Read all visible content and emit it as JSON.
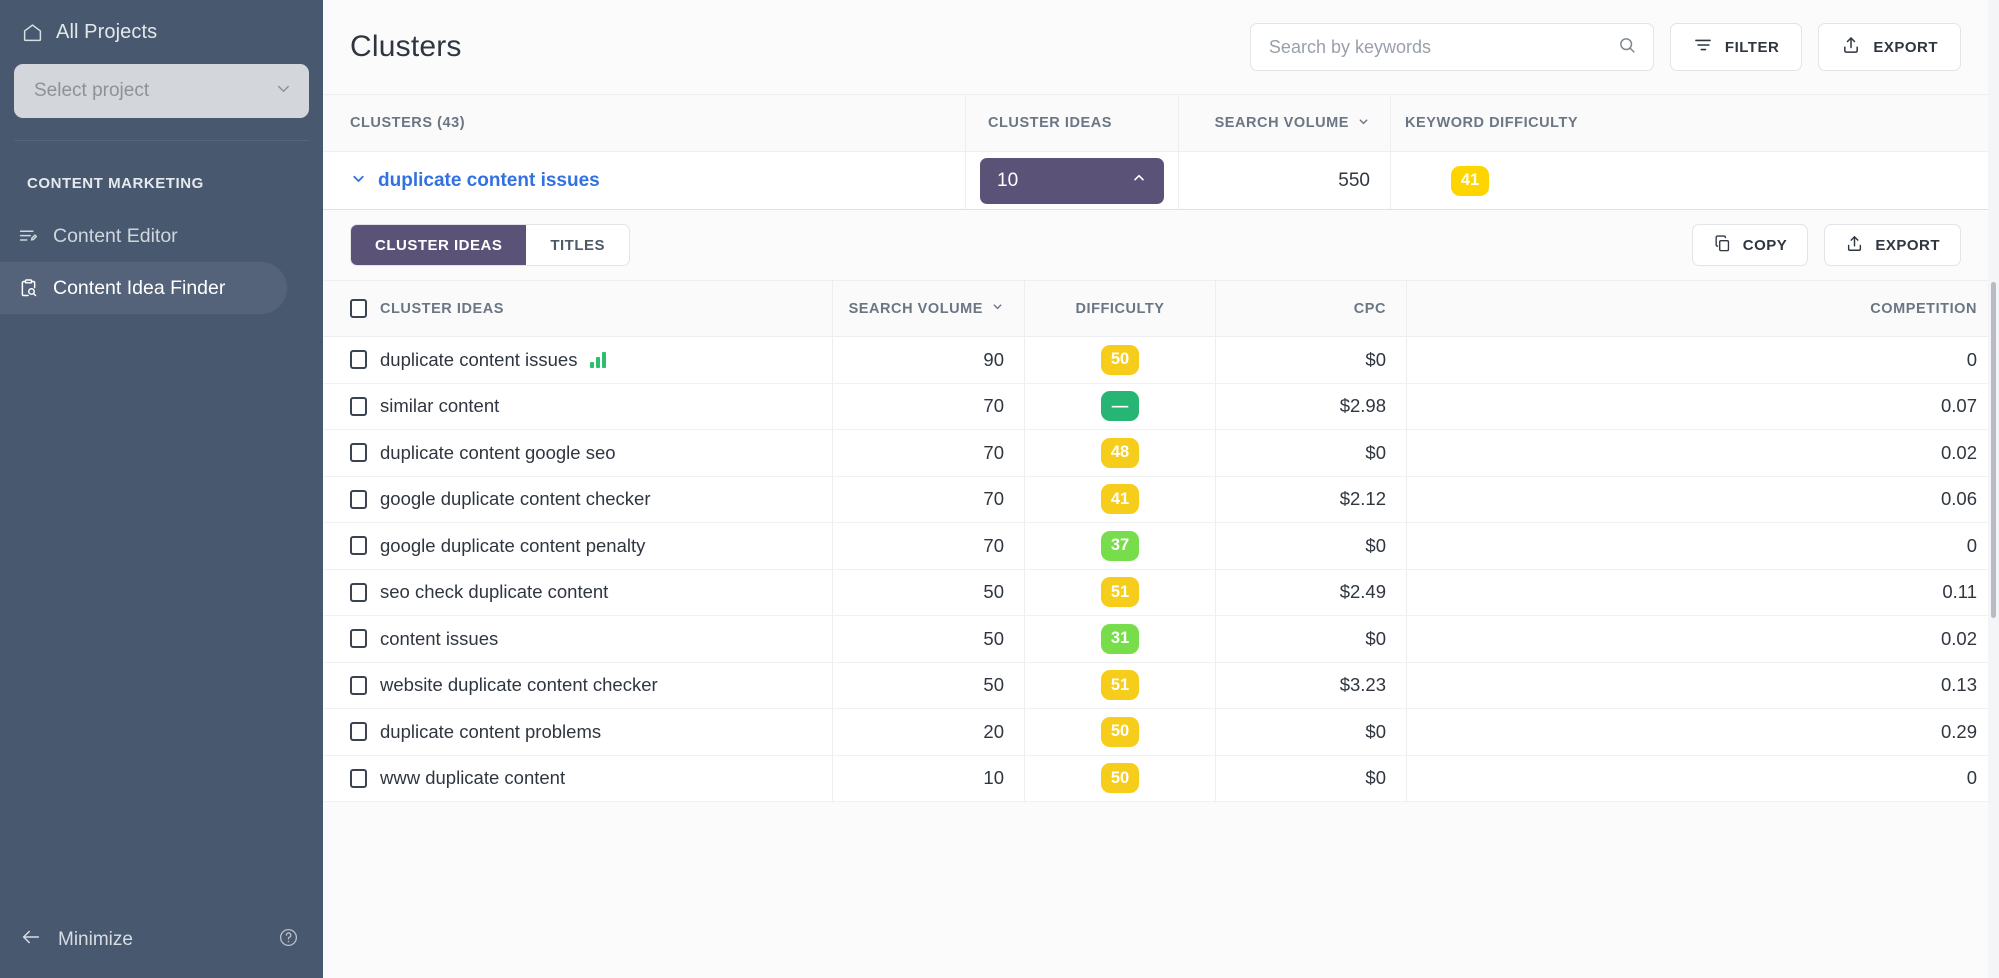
{
  "sidebar": {
    "all_projects_label": "All Projects",
    "project_select_placeholder": "Select project",
    "section_title": "CONTENT MARKETING",
    "items": [
      {
        "label": "Content Editor",
        "icon": "content-editor-icon",
        "active": false
      },
      {
        "label": "Content Idea Finder",
        "icon": "content-idea-finder-icon",
        "active": true
      }
    ],
    "minimize_label": "Minimize",
    "help_icon": "help-circle-icon"
  },
  "header": {
    "title": "Clusters",
    "search_placeholder": "Search by keywords",
    "search_value": "",
    "filter_label": "FILTER",
    "export_label": "EXPORT"
  },
  "clusters_table": {
    "columns": {
      "name": "CLUSTERS",
      "count": "(43)",
      "ideas": "CLUSTER IDEAS",
      "volume": "SEARCH VOLUME",
      "difficulty": "KEYWORD DIFFICULTY"
    },
    "expanded_row": {
      "keyword": "duplicate content issues",
      "ideas_count": "10",
      "search_volume": "550",
      "keyword_difficulty": "41",
      "kd_color": "#ffd500",
      "expanded": true
    }
  },
  "subtoolbar": {
    "tabs": [
      {
        "label": "CLUSTER IDEAS",
        "active": true
      },
      {
        "label": "TITLES",
        "active": false
      }
    ],
    "copy_label": "COPY",
    "export_label": "EXPORT"
  },
  "ideas_table": {
    "columns": [
      "CLUSTER IDEAS",
      "SEARCH VOLUME",
      "DIFFICULTY",
      "CPC",
      "COMPETITION"
    ],
    "rows": [
      {
        "keyword": "duplicate content issues",
        "volume": "90",
        "difficulty": "50",
        "diff_color": "#f7cd1b",
        "cpc": "$0",
        "competition": "0",
        "has_trend": true
      },
      {
        "keyword": "similar content",
        "volume": "70",
        "difficulty": "—",
        "diff_color": "#26b573",
        "cpc": "$2.98",
        "competition": "0.07",
        "has_trend": false
      },
      {
        "keyword": "duplicate content google seo",
        "volume": "70",
        "difficulty": "48",
        "diff_color": "#f7cd1b",
        "cpc": "$0",
        "competition": "0.02",
        "has_trend": false
      },
      {
        "keyword": "google duplicate content checker",
        "volume": "70",
        "difficulty": "41",
        "diff_color": "#f7cd1b",
        "cpc": "$2.12",
        "competition": "0.06",
        "has_trend": false
      },
      {
        "keyword": "google duplicate content penalty",
        "volume": "70",
        "difficulty": "37",
        "diff_color": "#77dd4a",
        "cpc": "$0",
        "competition": "0",
        "has_trend": false
      },
      {
        "keyword": "seo check duplicate content",
        "volume": "50",
        "difficulty": "51",
        "diff_color": "#f7cd1b",
        "cpc": "$2.49",
        "competition": "0.11",
        "has_trend": false
      },
      {
        "keyword": "content issues",
        "volume": "50",
        "difficulty": "31",
        "diff_color": "#77dd4a",
        "cpc": "$0",
        "competition": "0.02",
        "has_trend": false
      },
      {
        "keyword": "website duplicate content checker",
        "volume": "50",
        "difficulty": "51",
        "diff_color": "#f7cd1b",
        "cpc": "$3.23",
        "competition": "0.13",
        "has_trend": false
      },
      {
        "keyword": "duplicate content problems",
        "volume": "20",
        "difficulty": "50",
        "diff_color": "#f7cd1b",
        "cpc": "$0",
        "competition": "0.29",
        "has_trend": false
      },
      {
        "keyword": "www duplicate content",
        "volume": "10",
        "difficulty": "50",
        "diff_color": "#f7cd1b",
        "cpc": "$0",
        "competition": "0",
        "has_trend": false
      }
    ]
  },
  "theme": {
    "sidebar_bg": "#48586e",
    "accent_purple": "#5b5278",
    "link_blue": "#3272e0",
    "yellow": "#ffd500",
    "green": "#26b573"
  }
}
